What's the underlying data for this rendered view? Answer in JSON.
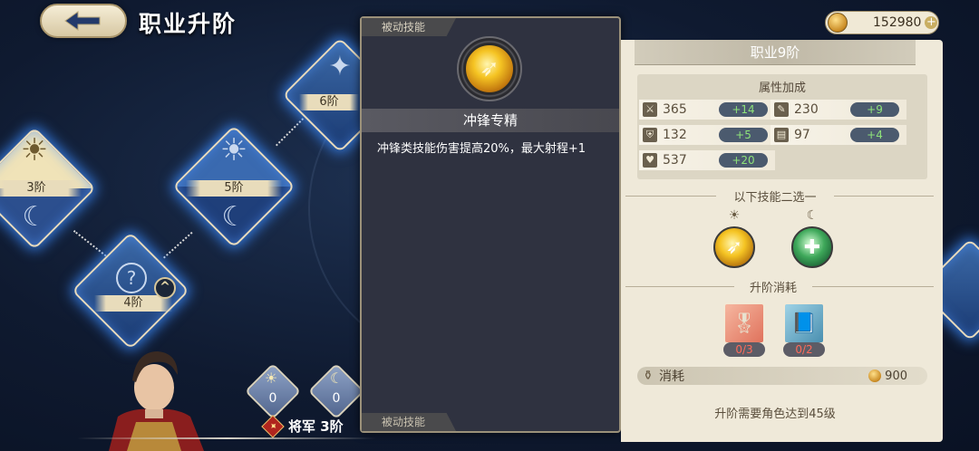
{
  "header": {
    "title": "职业升阶",
    "currency_value": "152980",
    "plus_label": "+"
  },
  "tree": {
    "nodes": [
      {
        "id": "rank3",
        "label": "3阶"
      },
      {
        "id": "rank4",
        "label": "4阶"
      },
      {
        "id": "rank5",
        "label": "5阶"
      },
      {
        "id": "rank6",
        "label": "6阶"
      }
    ],
    "upgrade_arrow": "^"
  },
  "character": {
    "counters": [
      {
        "icon": "sun",
        "value": "0"
      },
      {
        "icon": "moon",
        "value": "0"
      }
    ],
    "rank_text": "将军  3阶"
  },
  "skill_popup": {
    "tab_label": "被动技能",
    "bottom_tab_label": "被动技能",
    "skill_name": "冲锋专精",
    "description": "冲锋类技能伤害提高20%，最大射程+1"
  },
  "panel": {
    "title": "职业9阶",
    "attributes_title": "属性加成",
    "attributes": [
      {
        "icon": "sword-icon",
        "value": "365",
        "bonus": "+14"
      },
      {
        "icon": "wand-icon",
        "value": "230",
        "bonus": "+9"
      },
      {
        "icon": "shield-icon",
        "value": "132",
        "bonus": "+5"
      },
      {
        "icon": "book-icon",
        "value": "97",
        "bonus": "+4"
      },
      {
        "icon": "heart-icon",
        "value": "537",
        "bonus": "+20"
      }
    ],
    "choose_label": "以下技能二选一",
    "cost_section_label": "升阶消耗",
    "items": [
      {
        "icon": "medal-item-icon",
        "count": "0/3"
      },
      {
        "icon": "book-item-icon",
        "count": "0/2"
      }
    ],
    "cost_label": "消耗",
    "cost_value": "900",
    "requirement": "升阶需要角色达到45级"
  },
  "colors": {
    "background": "#0f1a30",
    "node_glow": "#3c8cff",
    "panel_bg": "#efe9d9",
    "bonus_green": "#8ee37a",
    "item_count_red": "#ff6b5a"
  }
}
